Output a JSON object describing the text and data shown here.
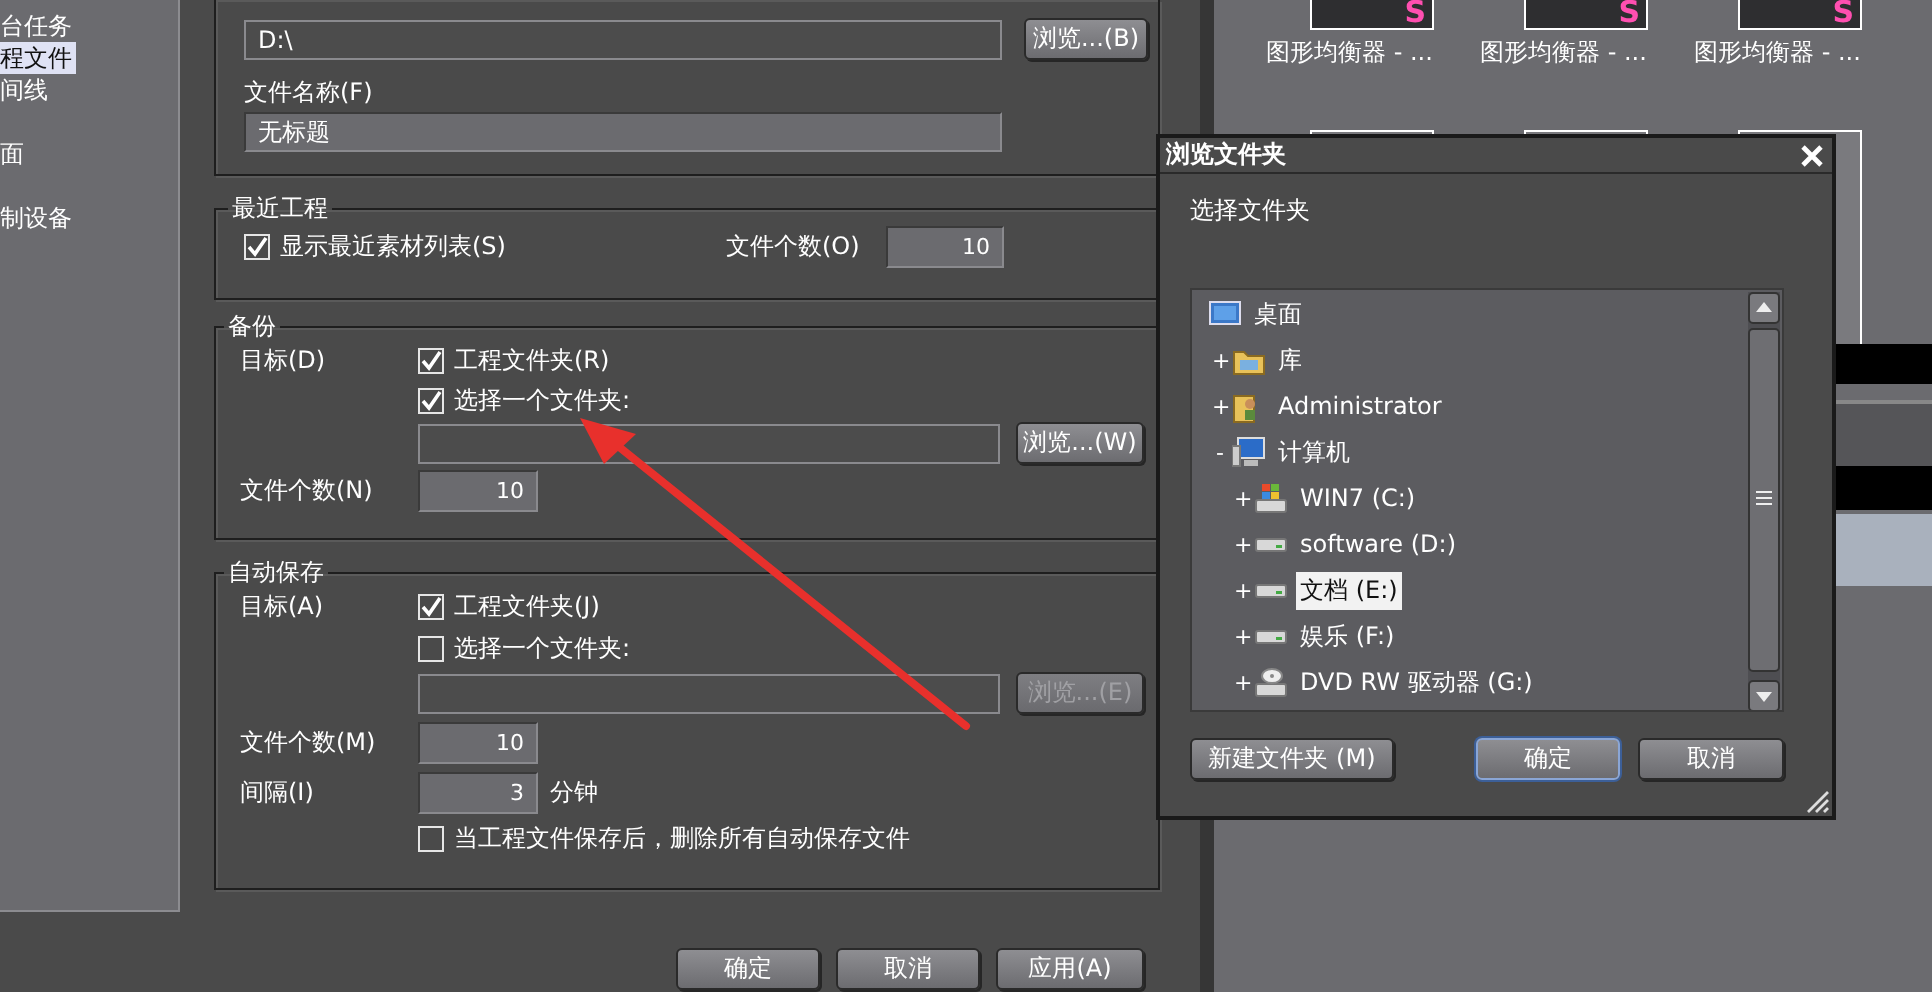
{
  "sidebar": {
    "items": [
      {
        "label": "台任务",
        "selected": false
      },
      {
        "label": "程文件",
        "selected": true
      },
      {
        "label": "间线",
        "selected": false
      },
      {
        "label": "面",
        "selected": false
      },
      {
        "label": "制设备",
        "selected": false
      }
    ]
  },
  "project_folder": {
    "path": "D:\\",
    "browse_button": {
      "label": "浏览...(B)",
      "disabled": false
    },
    "filename_label": "文件名称(F)",
    "filename": "无标题"
  },
  "recent_projects": {
    "title": "最近工程",
    "show_recent": {
      "label": "显示最近素材列表(S)",
      "checked": true
    },
    "count_label": "文件个数(O)",
    "count": "10"
  },
  "backup": {
    "title": "备份",
    "target_label": "目标(D)",
    "options": [
      {
        "label": "工程文件夹(R)",
        "checked": true
      },
      {
        "label": "选择一个文件夹:",
        "checked": true
      }
    ],
    "browse_button": {
      "label": "浏览...(W)",
      "disabled": false
    },
    "count_label": "文件个数(N)",
    "count": "10"
  },
  "autosave": {
    "title": "自动保存",
    "target_label": "目标(A)",
    "options": [
      {
        "label": "工程文件夹(J)",
        "checked": true
      },
      {
        "label": "选择一个文件夹:",
        "checked": false
      }
    ],
    "browse_button": {
      "label": "浏览...(E)",
      "disabled": true
    },
    "count_label": "文件个数(M)",
    "count": "10",
    "interval_label": "间隔(I)",
    "interval": "3",
    "interval_unit": "分钟",
    "delete_after_save": {
      "label": "当工程文件保存后，删除所有自动保存文件",
      "checked": false
    }
  },
  "buttons": [
    {
      "label": "确定"
    },
    {
      "label": "取消"
    },
    {
      "label": "应用(A)"
    }
  ],
  "effects": {
    "items": [
      {
        "label": "图形均衡器 - ...",
        "badge": "S"
      },
      {
        "label": "图形均衡器 - ...",
        "badge": "S"
      },
      {
        "label": "图形均衡器 - ...",
        "badge": "S"
      }
    ]
  },
  "dialog": {
    "title": "浏览文件夹",
    "prompt": "选择文件夹",
    "tree": [
      {
        "label": "桌面",
        "kind": "desktop",
        "selected": false,
        "children": [
          {
            "label": "库",
            "kind": "library",
            "toggle": "+",
            "selected": false
          },
          {
            "label": "Administrator",
            "kind": "user",
            "toggle": "+",
            "selected": false
          },
          {
            "label": "计算机",
            "kind": "computer",
            "toggle": "-",
            "selected": false,
            "children": [
              {
                "label": "WIN7 (C:)",
                "kind": "system-drive",
                "toggle": "+",
                "selected": false
              },
              {
                "label": "software (D:)",
                "kind": "drive",
                "toggle": "+",
                "selected": false
              },
              {
                "label": "文档 (E:)",
                "kind": "drive",
                "toggle": "+",
                "selected": true
              },
              {
                "label": "娱乐 (F:)",
                "kind": "drive",
                "toggle": "+",
                "selected": false
              },
              {
                "label": "DVD RW 驱动器 (G:)",
                "kind": "dvd-drive",
                "toggle": "+",
                "selected": false
              }
            ]
          }
        ]
      }
    ],
    "buttons": [
      {
        "label": "新建文件夹 (M)",
        "default": false
      },
      {
        "label": "确定",
        "default": true
      },
      {
        "label": "取消",
        "default": false
      }
    ]
  }
}
